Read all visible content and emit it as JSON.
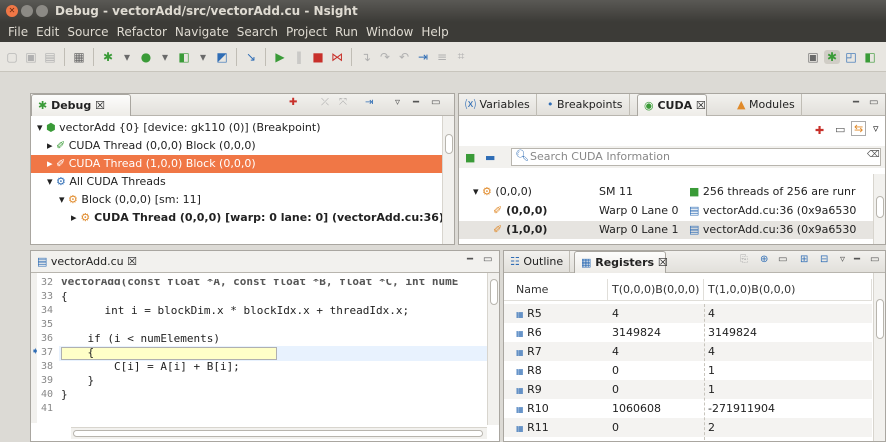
{
  "window": {
    "title": "Debug - vectorAdd/src/vectorAdd.cu - Nsight"
  },
  "menu": [
    "File",
    "Edit",
    "Source",
    "Refactor",
    "Navigate",
    "Search",
    "Project",
    "Run",
    "Window",
    "Help"
  ],
  "toolbar_icons": [
    "new-icon",
    "save-icon",
    "print-icon",
    "debug-icon",
    "run-icon",
    "external-tools-icon",
    "step-into-icon",
    "resume-icon",
    "suspend-icon",
    "terminate-icon",
    "disconnect-icon",
    "step-over-icon",
    "step-return-icon"
  ],
  "debug_view": {
    "tab": "Debug ☒",
    "rows": [
      "vectorAdd {0} [device: gk110 (0)] (Breakpoint)",
      "CUDA Thread (0,0,0) Block (0,0,0)",
      "CUDA Thread (1,0,0) Block (0,0,0)",
      "All CUDA Threads",
      "Block (0,0,0) [sm: 11]",
      "CUDA Thread (0,0,0) [warp: 0 lane: 0] (vectorAdd.cu:36)"
    ]
  },
  "cuda_view": {
    "tabs": [
      "Variables",
      "Breakpoints",
      "CUDA ☒",
      "Modules"
    ],
    "search_placeholder": "Search CUDA Information",
    "rows": [
      {
        "name": "(0,0,0)",
        "loc": "SM 11",
        "info": "256 threads of 256 are runr"
      },
      {
        "name": "(0,0,0)",
        "loc": "Warp 0 Lane 0",
        "info": "vectorAdd.cu:36 (0x9a6530"
      },
      {
        "name": "(1,0,0)",
        "loc": "Warp 0 Lane 1",
        "info": "vectorAdd.cu:36 (0x9a6530"
      }
    ]
  },
  "editor": {
    "tab": "vectorAdd.cu ☒",
    "lines": [
      {
        "n": "32",
        "t": "vectorAdd(const float *A, const float *B, float *C, int numE"
      },
      {
        "n": "33",
        "t": "{"
      },
      {
        "n": "34",
        "t": "    int i = blockDim.x * blockIdx.x + threadIdx.x;"
      },
      {
        "n": "35",
        "t": ""
      },
      {
        "n": "36",
        "t": "    if (i < numElements)"
      },
      {
        "n": "37",
        "t": "    {"
      },
      {
        "n": "38",
        "t": "        C[i] = A[i] + B[i];"
      },
      {
        "n": "39",
        "t": "    }"
      },
      {
        "n": "40",
        "t": "}"
      },
      {
        "n": "41",
        "t": ""
      }
    ]
  },
  "registers_view": {
    "tabs": [
      "Outline",
      "Registers ☒"
    ],
    "headers": [
      "Name",
      "T(0,0,0)B(0,0,0)",
      "T(1,0,0)B(0,0,0)"
    ],
    "rows": [
      [
        "R5",
        "4",
        "4"
      ],
      [
        "R6",
        "3149824",
        "3149824"
      ],
      [
        "R7",
        "4",
        "4"
      ],
      [
        "R8",
        "0",
        "1"
      ],
      [
        "R9",
        "0",
        "1"
      ],
      [
        "R10",
        "1060608",
        "-271911904"
      ],
      [
        "R11",
        "0",
        "2"
      ]
    ]
  }
}
